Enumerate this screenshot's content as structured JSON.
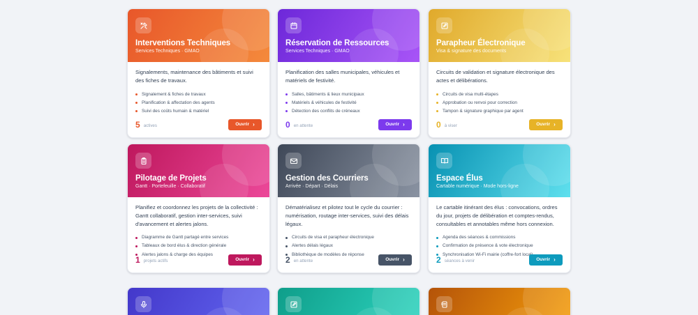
{
  "cards": [
    {
      "title": "Interventions Techniques",
      "subtitle": "Services Techniques · GMAO",
      "icon": "tools-icon",
      "gradient": [
        "#e8572a",
        "#f48a3c"
      ],
      "accent": "#e8572a",
      "description": "Signalements, maintenance des bâtiments et suivi des fiches de travaux.",
      "features": [
        "Signalement & fiches de travaux",
        "Planification & affectation des agents",
        "Suivi des coûts humain & matériel"
      ],
      "count": "5",
      "count_label": "actives",
      "button": "Ouvrir"
    },
    {
      "title": "Réservation de Ressources",
      "subtitle": "Services Techniques · GMAO",
      "icon": "calendar-icon",
      "gradient": [
        "#6d28d9",
        "#a855f7"
      ],
      "accent": "#7c3aed",
      "description": "Planification des salles municipales, véhicules et matériels de festivité.",
      "features": [
        "Salles, bâtiments & lieux municipaux",
        "Matériels & véhicules de festivité",
        "Détection des conflits de créneaux"
      ],
      "count": "0",
      "count_label": "en attente",
      "button": "Ouvrir"
    },
    {
      "title": "Parapheur Électronique",
      "subtitle": "Visa & signature des documents",
      "icon": "pen-icon",
      "gradient": [
        "#e0a92b",
        "#f7e27a"
      ],
      "accent": "#e7b327",
      "description": "Circuits de validation et signature électronique des actes et délibérations.",
      "features": [
        "Circuits de visa multi-étapes",
        "Approbation ou renvoi pour correction",
        "Tampon & signature graphique par agent"
      ],
      "count": "0",
      "count_label": "à viser",
      "button": "Ouvrir"
    },
    {
      "title": "Pilotage de Projets",
      "subtitle": "Gantt · Portefeuille · Collaboratif",
      "icon": "clipboard-icon",
      "gradient": [
        "#be185d",
        "#ec4899"
      ],
      "accent": "#be185d",
      "description": "Planifiez et coordonnez les projets de la collectivité : Gantt collaboratif, gestion inter-services, suivi d'avancement et alertes jalons.",
      "features": [
        "Diagramme de Gantt partagé entre services",
        "Tableaux de bord élus & direction générale",
        "Alertes jalons & charge des équipes"
      ],
      "count": "1",
      "count_label": "projets actifs",
      "button": "Ouvrir"
    },
    {
      "title": "Gestion des Courriers",
      "subtitle": "Arrivée · Départ · Délais",
      "icon": "mail-icon",
      "gradient": [
        "#3f4858",
        "#8a93a2"
      ],
      "accent": "#475467",
      "description": "Dématérialisez et pilotez tout le cycle du courrier : numérisation, routage inter-services, suivi des délais légaux.",
      "features": [
        "Circuits de visa et parapheur électronique",
        "Alertes délais légaux",
        "Bibliothèque de modèles de réponse"
      ],
      "count": "2",
      "count_label": "en attente",
      "button": "Ouvrir"
    },
    {
      "title": "Espace Élus",
      "subtitle": "Cartable numérique · Mode hors-ligne",
      "icon": "book-icon",
      "gradient": [
        "#0891b2",
        "#5fe0ee"
      ],
      "accent": "#0e9bbd",
      "description": "Le cartable itinérant des élus : convocations, ordres du jour, projets de délibération et comptes-rendus, consultables et annotables même hors connexion.",
      "features": [
        "Agenda des séances & commissions",
        "Confirmation de présence & vote électronique",
        "Synchronisation Wi-Fi mairie (coffre-fort local)"
      ],
      "count": "2",
      "count_label": "séances à venir",
      "button": "Ouvrir"
    },
    {
      "title": "",
      "subtitle": "",
      "icon": "microphone-icon",
      "gradient": [
        "#4338ca",
        "#6366f1"
      ],
      "accent": "#4f46e5"
    },
    {
      "title": "",
      "subtitle": "",
      "icon": "edit-icon",
      "gradient": [
        "#0f9e8a",
        "#2dd4bf"
      ],
      "accent": "#0d9488"
    },
    {
      "title": "",
      "subtitle": "",
      "icon": "receipt-icon",
      "gradient": [
        "#b45309",
        "#f59e0b"
      ],
      "accent": "#c2410c"
    }
  ]
}
